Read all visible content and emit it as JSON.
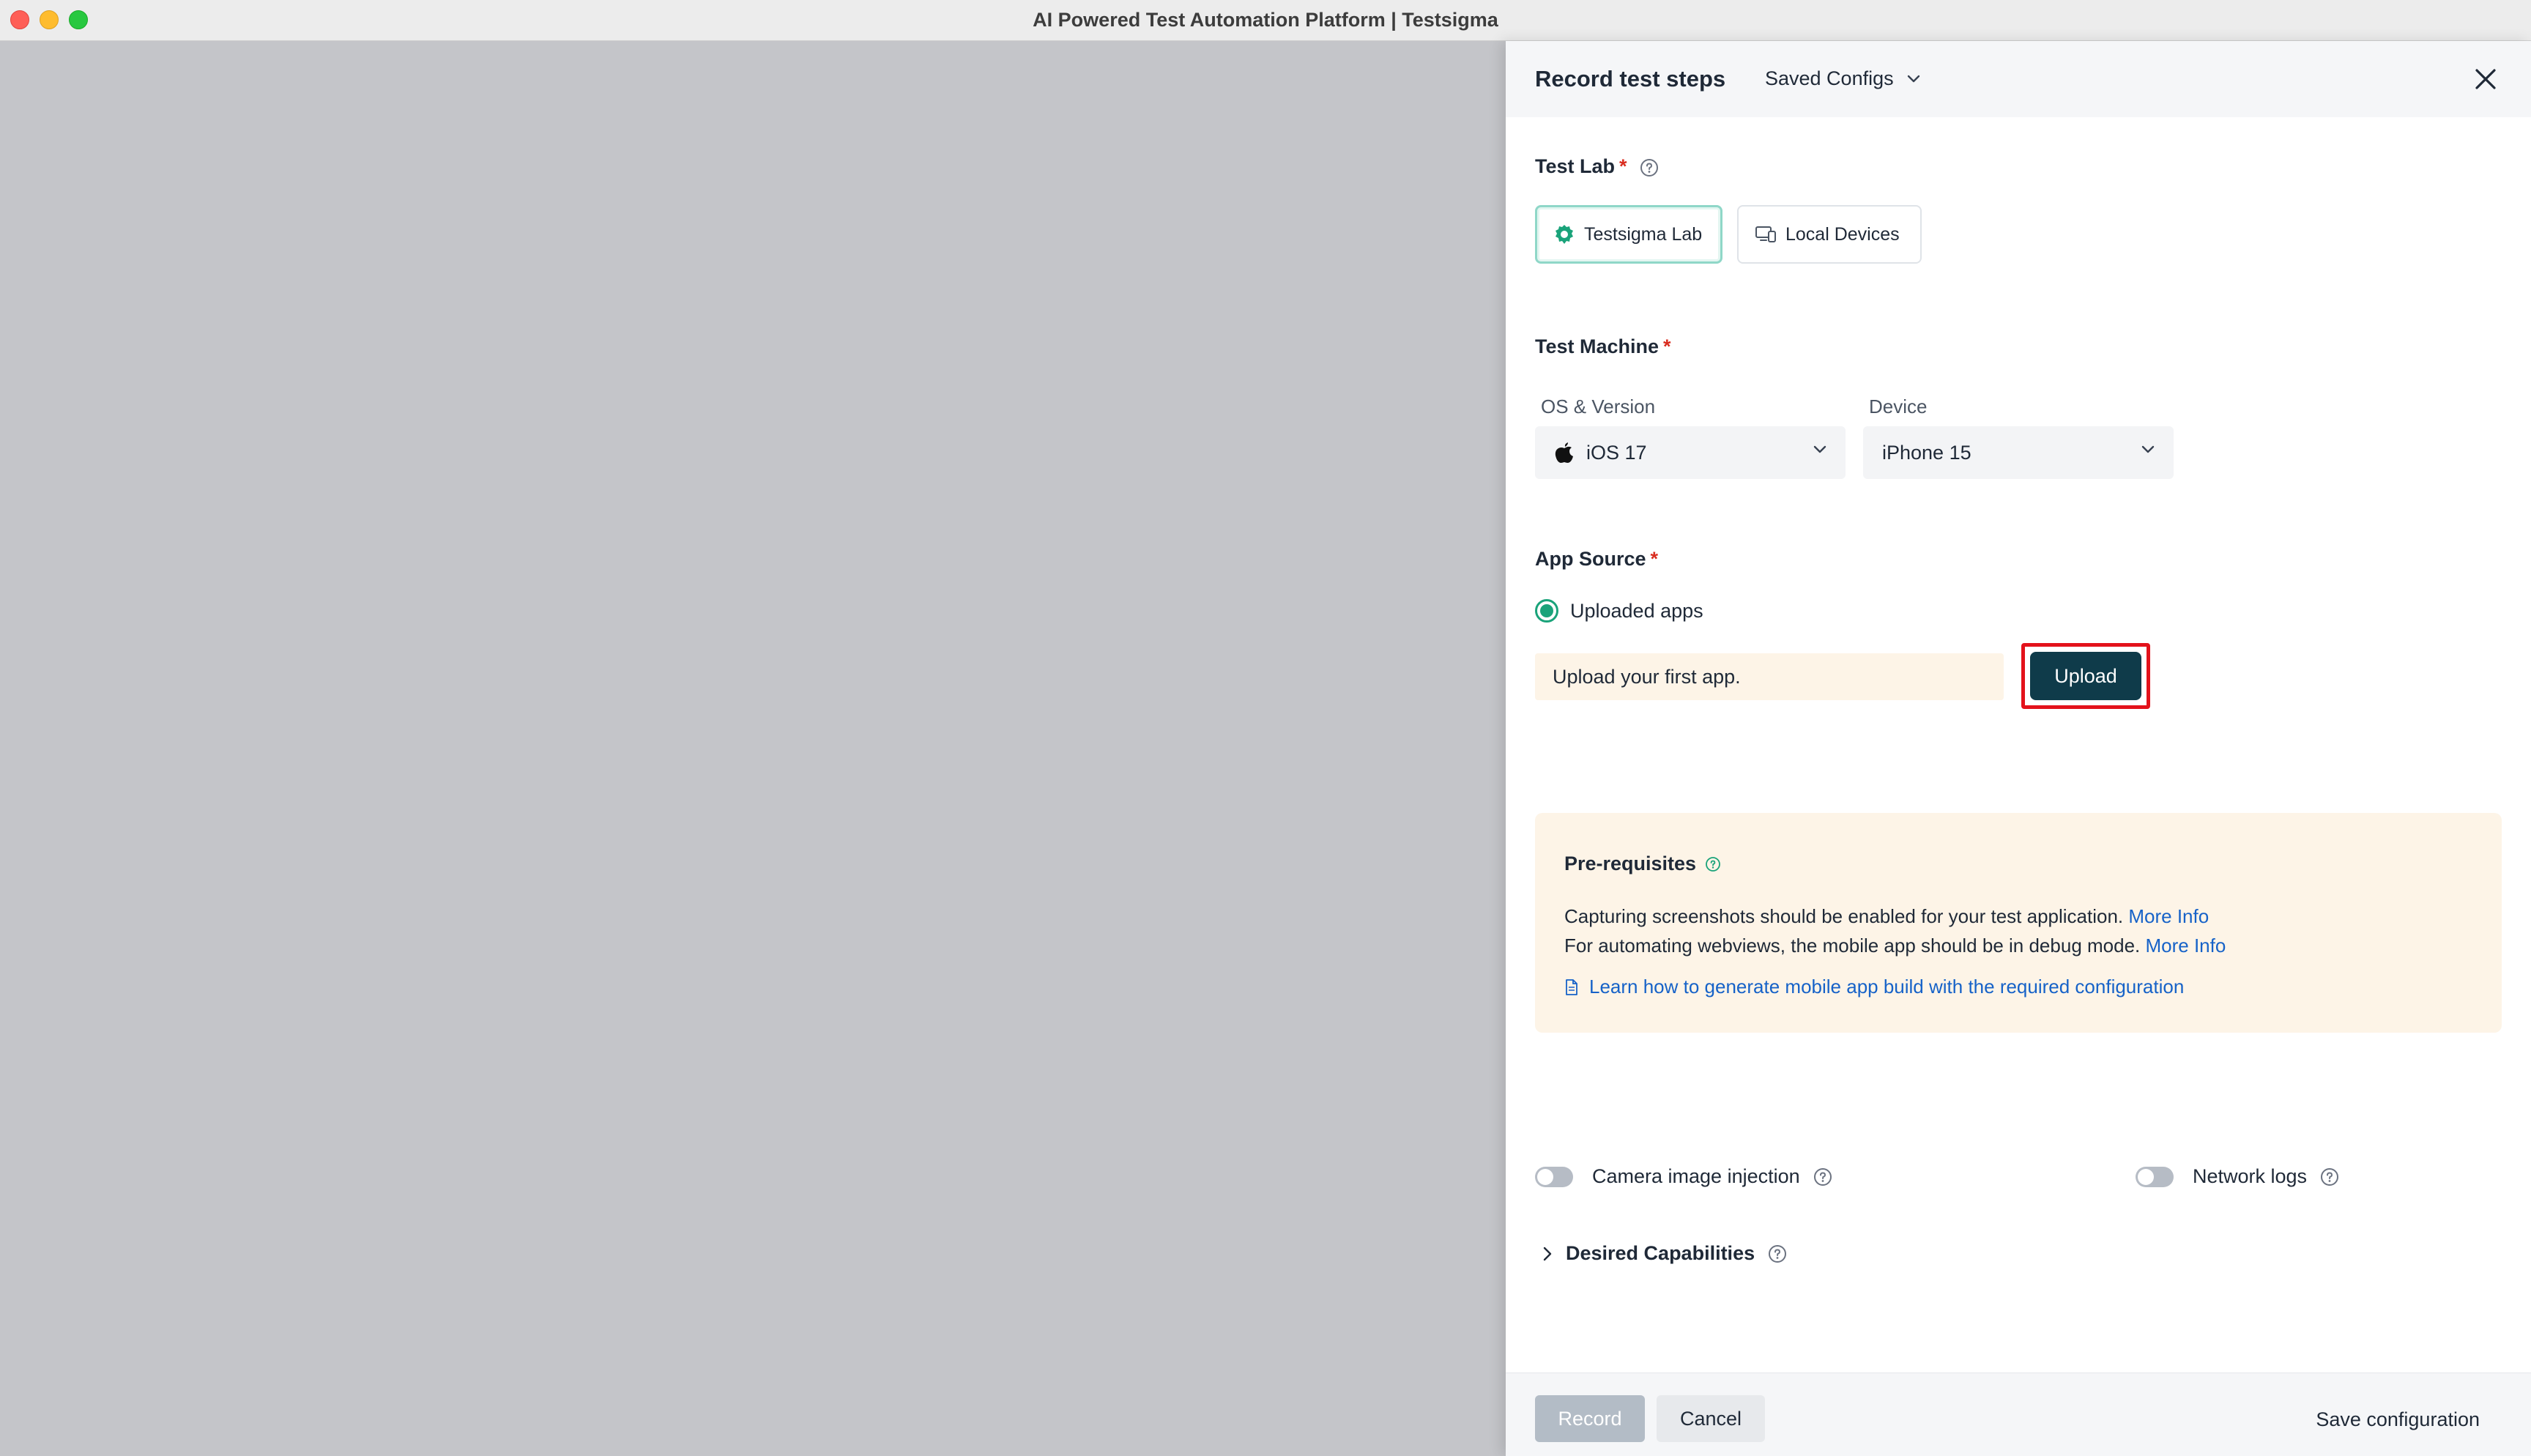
{
  "window": {
    "title": "AI Powered Test Automation Platform | Testsigma"
  },
  "drawer": {
    "title": "Record test steps",
    "saved_configs_label": "Saved Configs",
    "test_lab": {
      "label": "Test Lab",
      "required_mark": "*",
      "options": [
        {
          "label": "Testsigma Lab",
          "selected": true
        },
        {
          "label": "Local Devices",
          "selected": false
        }
      ]
    },
    "test_machine": {
      "label": "Test Machine",
      "required_mark": "*",
      "os_label": "OS & Version",
      "os_value": "iOS 17",
      "device_label": "Device",
      "device_value": "iPhone 15"
    },
    "app_source": {
      "label": "App Source",
      "required_mark": "*",
      "radio_label": "Uploaded apps",
      "hint": "Upload your first app.",
      "upload_label": "Upload"
    },
    "prerequisites": {
      "title": "Pre-requisites",
      "line1": "Capturing screenshots should be enabled for your test application.",
      "line1_link": "More Info",
      "line2": "For automating webviews, the mobile app should be in debug mode.",
      "line2_link": "More Info",
      "guide_link": "Learn how to generate mobile app build with the required configuration"
    },
    "toggles": {
      "camera_label": "Camera image injection",
      "camera_on": false,
      "network_label": "Network logs",
      "network_on": false
    },
    "desired_capabilities_label": "Desired Capabilities",
    "footer": {
      "record_label": "Record",
      "cancel_label": "Cancel",
      "save_label": "Save configuration"
    }
  },
  "colors": {
    "accent_green": "#1aa37a",
    "upload_button": "#0f3b4a",
    "highlight_red": "#e3121b",
    "link_blue": "#1662c8",
    "required_red": "#d92d20"
  }
}
